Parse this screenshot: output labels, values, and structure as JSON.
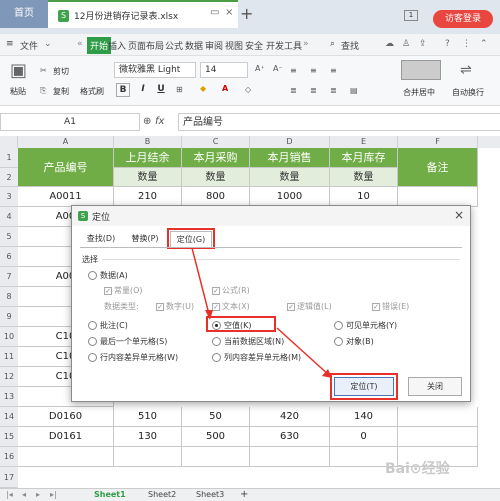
{
  "titlebar": {
    "home_tab": "首页",
    "file_tab": "12月份进销存记录表.xlsx",
    "file_badge": "S",
    "new_tab": "+",
    "badge_num": "1",
    "guest_login": "访客登录"
  },
  "menubar": {
    "file": "文件",
    "items": [
      "开始",
      "插入",
      "页面布局",
      "公式",
      "数据",
      "审阅",
      "视图",
      "安全",
      "开发工具"
    ],
    "more": "»",
    "search": "查找"
  },
  "ribbon": {
    "paste": "粘贴",
    "cut": "剪切",
    "copy": "复制",
    "format_painter": "格式刷",
    "font_name": "微软雅黑 Light",
    "font_size": "14",
    "bold": "B",
    "italic": "I",
    "underline": "U",
    "merge_center": "合并居中",
    "wrap_text": "自动换行"
  },
  "formula": {
    "cell_ref": "A1",
    "fx": "fx",
    "content": "产品编号"
  },
  "sheet": {
    "columns": [
      "A",
      "B",
      "C",
      "D",
      "E",
      "F"
    ],
    "rows": [
      "1",
      "2",
      "3",
      "4",
      "5",
      "6",
      "7",
      "8",
      "9",
      "10",
      "11",
      "12",
      "13",
      "14",
      "15",
      "16",
      "17"
    ],
    "header": {
      "product": "产品编号",
      "b": "上月结余",
      "c": "本月采购",
      "d": "本月销售",
      "e": "本月库存",
      "f": "备注",
      "qty": "数量"
    },
    "visible_rows": {
      "r3": [
        "A0011",
        "210",
        "800",
        "1000",
        "10"
      ],
      "r4": [
        "A00",
        "",
        "",
        "",
        ""
      ],
      "r7": [
        "A00",
        "",
        "",
        "",
        ""
      ],
      "r10": [
        "C10",
        "",
        "",
        "",
        ""
      ],
      "r11": [
        "C10",
        "",
        "",
        "",
        ""
      ],
      "r12": [
        "C10",
        "",
        "",
        "",
        ""
      ],
      "r14": [
        "D0160",
        "510",
        "50",
        "420",
        "140"
      ],
      "r15": [
        "D0161",
        "130",
        "500",
        "630",
        "0"
      ]
    }
  },
  "dialog": {
    "title": "定位",
    "icon_letter": "S",
    "tabs": [
      "查找(D)",
      "替换(P)",
      "定位(G)"
    ],
    "section": "选择",
    "data_type_label": "数据类型:",
    "options": {
      "data": "数据(A)",
      "constant": "常量(O)",
      "formula": "公式(R)",
      "number": "数字(U)",
      "text": "文本(X)",
      "logical": "逻辑值(L)",
      "error": "错误(E)",
      "comment": "批注(C)",
      "blank": "空值(K)",
      "visible_cells": "可见单元格(Y)",
      "last_cell": "最后一个单元格(S)",
      "current_region": "当前数据区域(N)",
      "object": "对象(B)",
      "row_diff": "行内容差异单元格(W)",
      "col_diff": "列内容差异单元格(M)"
    },
    "ok": "定位(T)",
    "close": "关闭"
  },
  "sheettabs": [
    "Sheet1",
    "Sheet2",
    "Sheet3",
    "+"
  ],
  "colors": {
    "header_green": "#70ad47",
    "sub_green": "#e2eedb",
    "accent_red": "#e8302a",
    "start_green": "#2f9d47"
  }
}
